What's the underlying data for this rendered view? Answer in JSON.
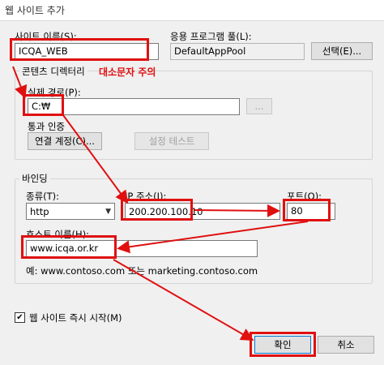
{
  "window": {
    "title": "웹 사이트 추가"
  },
  "site_name": {
    "label": "사이트 이름(S):",
    "value": "ICQA_WEB"
  },
  "app_pool": {
    "label": "응용 프로그램 풀(L):",
    "value": "DefaultAppPool",
    "select_button": "선택(E)..."
  },
  "content_dir": {
    "group_label": "콘텐츠 디렉터리",
    "annotation": "대소문자 주의",
    "physical_path_label": "실제 경로(P):",
    "physical_path_value": "C:₩",
    "browse_button": "...",
    "auth_label": "통과 인증",
    "connect_as_button": "연결 계정(C)...",
    "test_settings_button": "설정 테스트"
  },
  "binding": {
    "group_label": "바인딩",
    "type_label": "종류(T):",
    "type_value": "http",
    "ip_label": "IP 주소(I):",
    "ip_value": "200.200.100.10",
    "port_label": "포트(O):",
    "port_value": "80",
    "host_label": "호스트 이름(H):",
    "host_value": "www.icqa.or.kr",
    "example": "예: www.contoso.com 또는 marketing.contoso.com"
  },
  "start_immediately": {
    "label": "웹 사이트 즉시 시작(M)",
    "checked": true,
    "check_glyph": "✔"
  },
  "footer": {
    "ok_button": "확인",
    "cancel_button": "취소"
  },
  "colors": {
    "annotation_red": "#e01010",
    "focus_blue": "#0078d7"
  }
}
